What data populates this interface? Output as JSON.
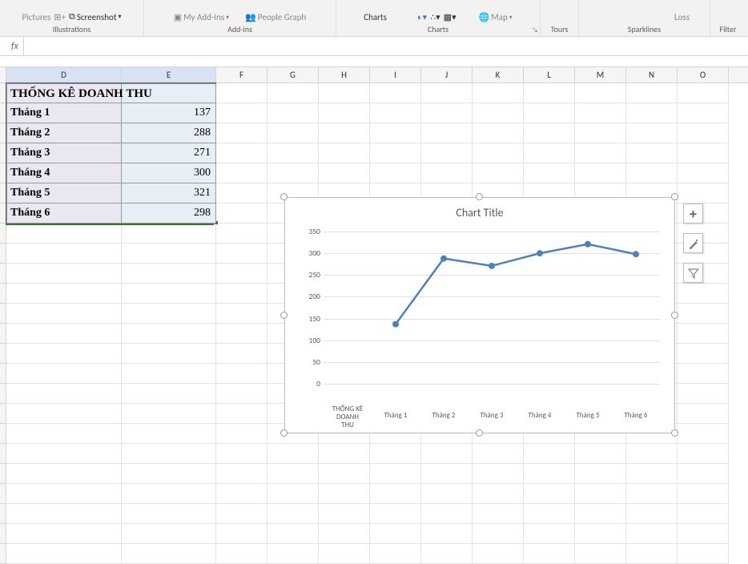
{
  "ribbon": {
    "pictures": "Pictures",
    "screenshot": "Screenshot",
    "my_addins": "My Add-Ins",
    "people_graph": "People Graph",
    "charts": "Charts",
    "map": "Map",
    "loss": "Loss",
    "filter": "Filter",
    "groups": {
      "illustrations": "Illustrations",
      "addins": "Add-ins",
      "charts": "Charts",
      "tours": "Tours",
      "sparklines": "Sparklines"
    }
  },
  "formula_bar": {
    "fx": "fx",
    "value": ""
  },
  "columns": [
    "D",
    "E",
    "F",
    "G",
    "H",
    "I",
    "J",
    "K",
    "L",
    "M",
    "N",
    "O"
  ],
  "table": {
    "title": "THỐNG KÊ DOANH THU",
    "rows": [
      {
        "label": "Tháng 1",
        "value": 137
      },
      {
        "label": "Tháng 2",
        "value": 288
      },
      {
        "label": "Tháng 3",
        "value": 271
      },
      {
        "label": "Tháng 4",
        "value": 300
      },
      {
        "label": "Tháng 5",
        "value": 321
      },
      {
        "label": "Tháng 6",
        "value": 298
      }
    ]
  },
  "chart_data": {
    "type": "line",
    "title": "Chart Title",
    "categories": [
      "THỐNG KÊ DOANH THU",
      "Tháng 1",
      "Tháng 2",
      "Tháng 3",
      "Tháng 4",
      "Tháng 5",
      "Tháng 6"
    ],
    "values": [
      null,
      137,
      288,
      271,
      300,
      321,
      298
    ],
    "ylim": [
      0,
      350
    ],
    "ystep": 50,
    "xlabel": "",
    "ylabel": ""
  },
  "chart_buttons": {
    "plus": "+",
    "brush": "brush",
    "filter": "filter"
  }
}
